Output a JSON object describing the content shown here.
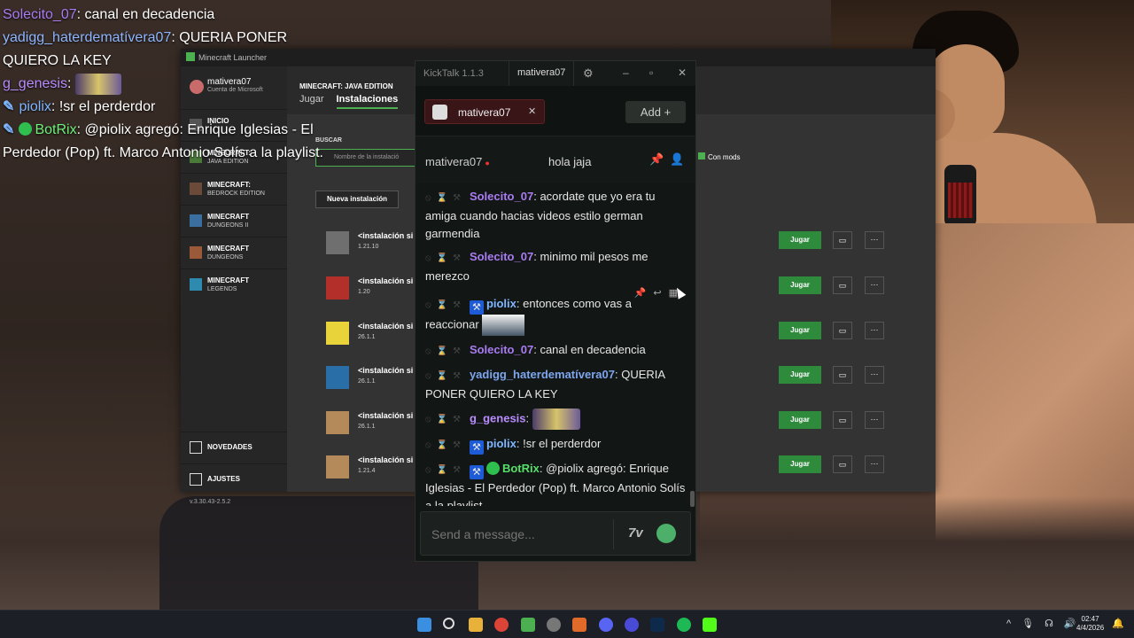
{
  "stream_chat": [
    {
      "user": "Solecito_07",
      "text": ": canal en decadencia"
    },
    {
      "user": "yadigg_haterdematívera07",
      "text": ": QUERIA PONER QUIERO LA KEY"
    },
    {
      "user": "g_genesis",
      "text": ":"
    },
    {
      "user": "piolix",
      "text": ": !sr el perderdor"
    },
    {
      "user": "BotRix",
      "text": ": @piolix agregó: Enrique Iglesias - El Perdedor (Pop) ft. Marco Antonio Solís a la playlist."
    }
  ],
  "launcher": {
    "window_title": "Minecraft Launcher",
    "account_name": "mativera07",
    "account_sub": "Cuenta de Microsoft",
    "sidebar": [
      {
        "label": "INICIO",
        "sub": ""
      },
      {
        "label": "MINECRAFT:",
        "sub": "JAVA EDITION"
      },
      {
        "label": "MINECRAFT:",
        "sub": "BEDROCK EDITION"
      },
      {
        "label": "MINECRAFT",
        "sub": "DUNGEONS II"
      },
      {
        "label": "MINECRAFT",
        "sub": "DUNGEONS"
      },
      {
        "label": "MINECRAFT",
        "sub": "LEGENDS"
      }
    ],
    "news": "NOVEDADES",
    "settings": "AJUSTES",
    "version": "v.3.30.43-2.5.2",
    "edition": "MINECRAFT: JAVA EDITION",
    "tabs": [
      "Jugar",
      "Instalaciones"
    ],
    "search_label": "BUSCAR",
    "search_placeholder": "Nombre de la instalació",
    "mods_label": "Con mods",
    "new_install": "Nueva instalación",
    "play_label": "Jugar",
    "installs": [
      {
        "name": "<instalación si",
        "version": "1.21.10"
      },
      {
        "name": "<instalación si",
        "version": "1.20"
      },
      {
        "name": "<instalación si",
        "version": "26.1.1"
      },
      {
        "name": "<instalación si",
        "version": "26.1.1"
      },
      {
        "name": "<instalación si",
        "version": "26.1.1"
      },
      {
        "name": "<instalación si",
        "version": "1.21.4"
      }
    ]
  },
  "kicktalk": {
    "app_name": "KickTalk 1.1.3",
    "title_user": "mativera07",
    "tab_name": "mativera07",
    "add_label": "Add",
    "channel": "mativera07",
    "stream_title": "hola jaja",
    "messages": [
      {
        "user": "Solecito_07",
        "text": "acordate que yo era tu amiga cuando hacias videos estilo german garmendia"
      },
      {
        "user": "Solecito_07",
        "text": "minimo mil pesos me merezco"
      },
      {
        "user": "piolix",
        "text": "entonces como vas a reaccionar"
      },
      {
        "user": "Solecito_07",
        "text": "canal en decadencia"
      },
      {
        "user": "yadigg_haterdematívera07",
        "text": "QUERIA PONER QUIERO LA KEY"
      },
      {
        "user": "g_genesis",
        "text": ""
      },
      {
        "user": "piolix",
        "text": "!sr el perderdor"
      },
      {
        "user": "BotRix",
        "text": "@piolix agregó: Enrique Iglesias - El Perdedor (Pop) ft. Marco Antonio Solís a la playlist."
      }
    ],
    "input_placeholder": "Send a message...",
    "sevtv_label": "7tv"
  },
  "taskbar": {
    "time": "02:47",
    "date": "4/4/2026"
  }
}
